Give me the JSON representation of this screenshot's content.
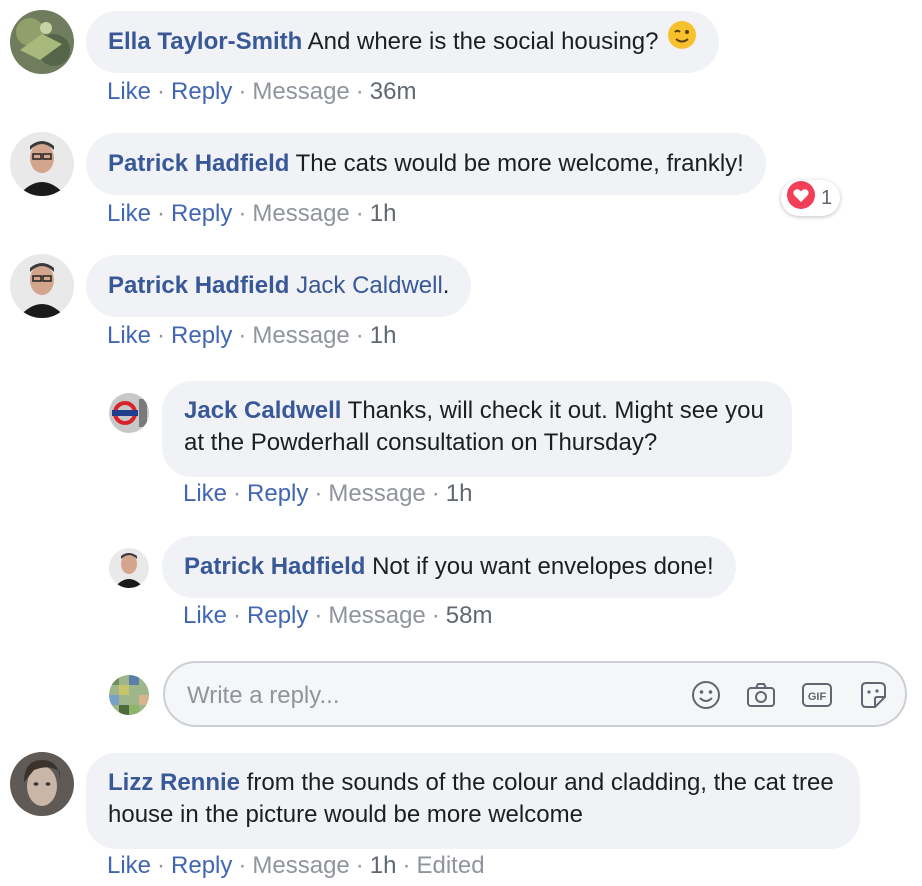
{
  "comments": [
    {
      "author": "Ella Taylor-Smith",
      "text": " And where is the social housing? ",
      "actions": {
        "like": "Like",
        "reply": "Reply",
        "message": "Message",
        "time": "36m"
      }
    },
    {
      "author": "Patrick Hadfield",
      "text": " The cats would be more welcome, frankly!",
      "actions": {
        "like": "Like",
        "reply": "Reply",
        "message": "Message",
        "time": "1h"
      },
      "reaction": {
        "icon": "heart-reaction-icon",
        "count": "1",
        "color": "#f33e58"
      }
    },
    {
      "author": "Patrick Hadfield",
      "mention": "Jack Caldwell",
      "text": ".",
      "actions": {
        "like": "Like",
        "reply": "Reply",
        "message": "Message",
        "time": "1h"
      }
    },
    {
      "author": "Jack Caldwell",
      "text": " Thanks, will check it out. Might see you at the Powderhall consultation on Thursday?",
      "actions": {
        "like": "Like",
        "reply": "Reply",
        "message": "Message",
        "time": "1h"
      }
    },
    {
      "author": "Patrick Hadfield",
      "text": " Not if you want envelopes done!",
      "actions": {
        "like": "Like",
        "reply": "Reply",
        "message": "Message",
        "time": "58m"
      }
    },
    {
      "author": "Lizz Rennie",
      "text": " from the sounds of the colour and cladding, the cat tree house in the picture would be more welcome",
      "actions": {
        "like": "Like",
        "reply": "Reply",
        "message": "Message",
        "time": "1h",
        "edited": "Edited"
      }
    }
  ],
  "reply_box": {
    "placeholder": "Write a reply...",
    "tools": [
      "emoji-icon",
      "camera-icon",
      "gif-icon",
      "sticker-icon"
    ]
  },
  "colors": {
    "link": "#385898",
    "action": "#4267b2",
    "muted": "#90949c",
    "bubble": "#f0f2f5"
  }
}
